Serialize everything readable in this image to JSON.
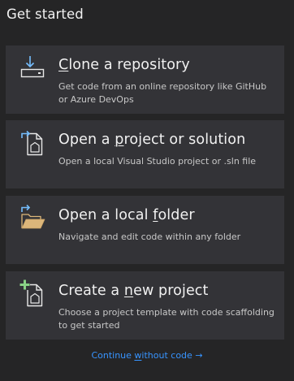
{
  "page": {
    "title": "Get started"
  },
  "cards": [
    {
      "icon": "clone-download-icon",
      "label_pre": "",
      "label_ul": "C",
      "label_post": "lone a repository",
      "desc": "Get code from an online repository like GitHub or Azure DevOps"
    },
    {
      "icon": "open-project-icon",
      "label_pre": "Open a ",
      "label_ul": "p",
      "label_post": "roject or solution",
      "desc": "Open a local Visual Studio project or .sln file"
    },
    {
      "icon": "open-folder-icon",
      "label_pre": "Open a local ",
      "label_ul": "f",
      "label_post": "older",
      "desc": "Navigate and edit code within any folder"
    },
    {
      "icon": "new-project-icon",
      "label_pre": "Create a ",
      "label_ul": "n",
      "label_post": "ew project",
      "desc": "Choose a project template with code scaffolding to get started"
    }
  ],
  "continue_link": {
    "pre": "Continue ",
    "ul": "w",
    "post": "ithout code",
    "arrow": "→"
  },
  "colors": {
    "background": "#252526",
    "card": "#333337",
    "link": "#3794ff",
    "icon_blue": "#75beff",
    "folder": "#dcb67a",
    "plus_green": "#89d185"
  }
}
